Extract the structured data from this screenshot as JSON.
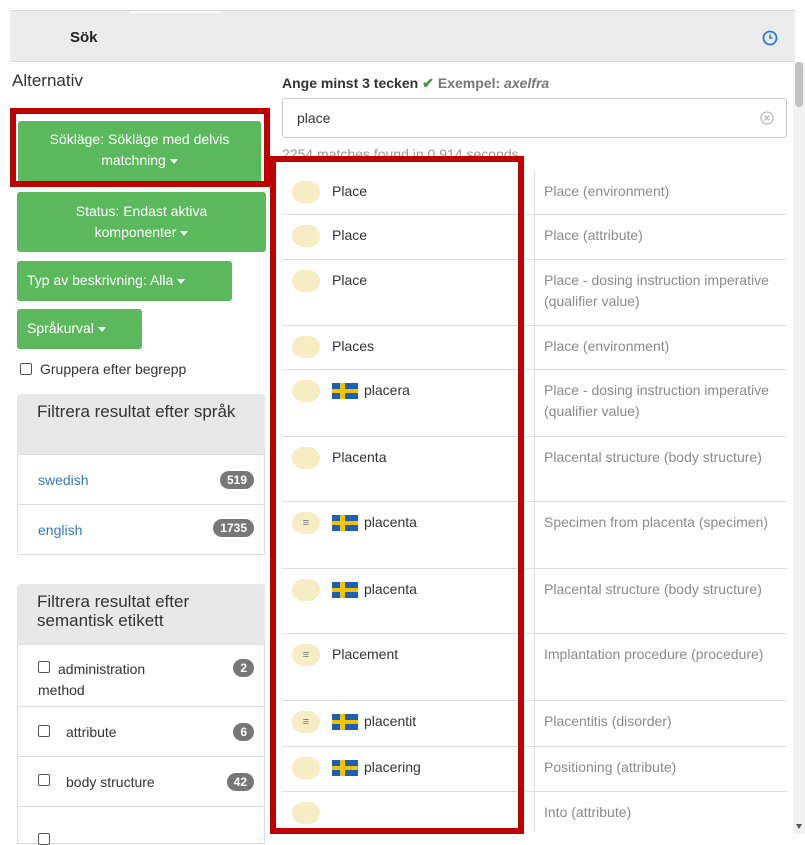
{
  "header": {
    "title": "Sök",
    "history_icon": "clock-icon"
  },
  "sidebar": {
    "title": "Alternativ",
    "search_mode_button": "Sökläge: Sökläge med delvis matchning",
    "status_button": "Status: Endast aktiva komponenter",
    "description_type_button": "Typ av beskrivning: Alla",
    "language_button": "Språkurval",
    "group_by_concept_label": "Gruppera efter begrepp",
    "language_filter": {
      "heading": "Filtrera resultat efter språk",
      "items": [
        {
          "label": "swedish",
          "count": "519"
        },
        {
          "label": "english",
          "count": "1735"
        }
      ]
    },
    "semantic_filter": {
      "heading": "Filtrera resultat efter semantisk etikett",
      "items": [
        {
          "label": "administration method",
          "count": "2"
        },
        {
          "label": "attribute",
          "count": "6"
        },
        {
          "label": "body structure",
          "count": "42"
        }
      ]
    }
  },
  "search": {
    "hint_prefix": "Ange minst 3 tecken",
    "hint_example_label": "Exempel:",
    "hint_example_value": "axelfra",
    "value": "place",
    "matches_text": "2254 matches found in 0.914 seconds."
  },
  "results": [
    {
      "pill": "",
      "flag": false,
      "term": "Place",
      "description": "Place (environment)"
    },
    {
      "pill": "",
      "flag": false,
      "term": "Place",
      "description": "Place (attribute)"
    },
    {
      "pill": "",
      "flag": false,
      "term": "Place",
      "description": "Place - dosing instruction imperative (qualifier value)"
    },
    {
      "pill": "",
      "flag": false,
      "term": "Places",
      "description": "Place (environment)"
    },
    {
      "pill": "",
      "flag": true,
      "term": "placera",
      "description": "Place - dosing instruction imperative (qualifier value)"
    },
    {
      "pill": "",
      "flag": false,
      "term": "Placenta",
      "description": "Placental structure (body structure)"
    },
    {
      "pill": "≡",
      "flag": true,
      "term": "placenta",
      "description": "Specimen from placenta (specimen)"
    },
    {
      "pill": "",
      "flag": true,
      "term": "placenta",
      "description": "Placental structure (body structure)"
    },
    {
      "pill": "≡",
      "flag": false,
      "term": "Placement",
      "description": "Implantation procedure (procedure)"
    },
    {
      "pill": "≡",
      "flag": true,
      "term": "placentit",
      "description": "Placentitis (disorder)"
    },
    {
      "pill": "",
      "flag": true,
      "term": "placering",
      "description": "Positioning (attribute)"
    },
    {
      "pill": "",
      "flag": false,
      "term": "",
      "description": "Into (attribute)"
    }
  ],
  "colors": {
    "green_button": "#5cb85c",
    "highlight_box": "#c00000",
    "badge": "#777777",
    "link": "#337ab7"
  }
}
